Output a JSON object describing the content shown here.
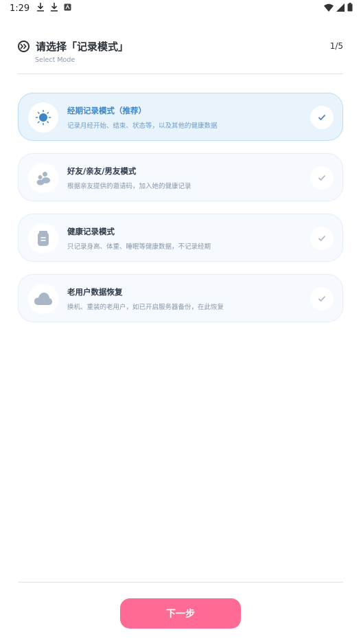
{
  "status_bar": {
    "time": "1:29"
  },
  "header": {
    "title": "请选择「记录模式」",
    "subtitle": "Select Mode",
    "step": "1/5"
  },
  "options": [
    {
      "title": "经期记录模式（推荐）",
      "desc": "记录月经开始、结束、状态等，以及其他的健康数据",
      "icon": "sun-icon",
      "selected": true
    },
    {
      "title": "好友/亲友/男友模式",
      "desc": "根据亲友提供的邀请码，加入她的健康记录",
      "icon": "people-icon",
      "selected": false
    },
    {
      "title": "健康记录模式",
      "desc": "只记录身高、体重、睡眠等健康数据，不记录经期",
      "icon": "clipboard-icon",
      "selected": false
    },
    {
      "title": "老用户数据恢复",
      "desc": "换机、重装的老用户，如已开启服务器备份，在此恢复",
      "icon": "cloud-icon",
      "selected": false
    }
  ],
  "footer": {
    "next_label": "下一步"
  },
  "colors": {
    "accent": "#ff6b94",
    "selected_text": "#3f86c8",
    "selected_bg": "#e8f3fc"
  }
}
